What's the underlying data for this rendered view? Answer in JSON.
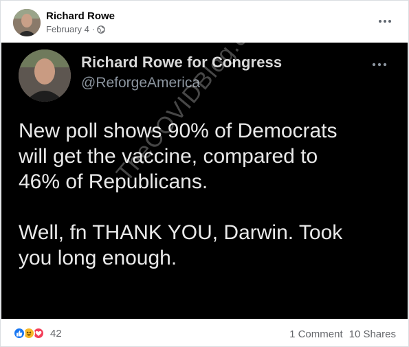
{
  "post": {
    "author": "Richard Rowe",
    "date": "February 4 ·",
    "privacy_icon": "globe-icon",
    "more_icon": "more-horizontal-icon"
  },
  "embed": {
    "name": "Richard Rowe for Congress",
    "handle": "@ReforgeAmerica",
    "text": "New poll shows 90% of Democrats\nwill get the vaccine, compared to\n46% of Republicans.\n\nWell, fn THANK YOU, Darwin. Took\nyou long enough.",
    "watermark": "TheCOVIDBlog.com"
  },
  "footer": {
    "reactions": [
      "like-icon",
      "haha-icon",
      "love-icon"
    ],
    "reaction_count": "42",
    "comments": "1 Comment",
    "shares": "10 Shares"
  },
  "colors": {
    "accent": "#1877f2",
    "haha": "#f7b928",
    "love": "#f33e58",
    "secondary_text": "#65676b",
    "embed_bg": "#000000"
  }
}
